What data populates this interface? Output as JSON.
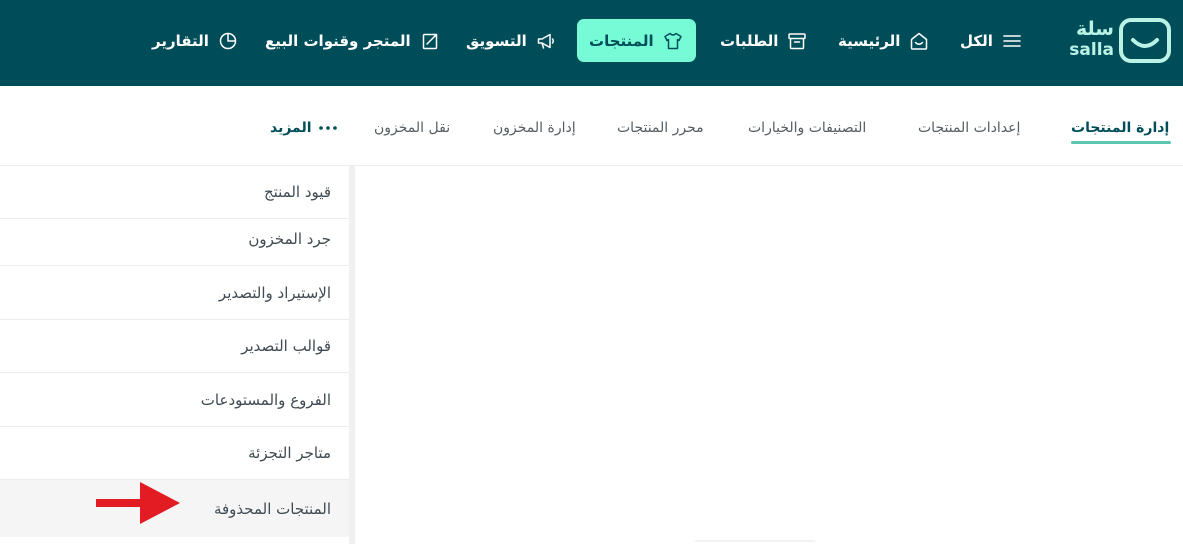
{
  "brand": {
    "name_ar": "سلة",
    "name_latin": "salla"
  },
  "nav": {
    "menu_label": "الكل",
    "items": [
      {
        "key": "home",
        "label": "الرئيسية",
        "icon": "home-icon"
      },
      {
        "key": "orders",
        "label": "الطلبات",
        "icon": "archive-box-icon"
      },
      {
        "key": "products",
        "label": "المنتجات",
        "icon": "shirt-icon",
        "active": true
      },
      {
        "key": "marketing",
        "label": "التسويق",
        "icon": "megaphone-icon"
      },
      {
        "key": "channels",
        "label": "المتجر وقنوات البيع",
        "icon": "store-channels-icon"
      },
      {
        "key": "reports",
        "label": "التقارير",
        "icon": "pie-chart-icon"
      }
    ]
  },
  "tabs": {
    "items": [
      {
        "label": "إدارة المنتجات",
        "active": true
      },
      {
        "label": "إعدادات المنتجات"
      },
      {
        "label": "التصنيفات والخيارات"
      },
      {
        "label": "محرر المنتجات"
      },
      {
        "label": "إدارة المخزون"
      },
      {
        "label": "نقل المخزون"
      }
    ],
    "more_label": "المزيد"
  },
  "menu": {
    "items": [
      {
        "label": "قيود المنتج"
      },
      {
        "label": "جرد المخزون"
      },
      {
        "label": "الإستيراد والتصدير"
      },
      {
        "label": "قوالب التصدير"
      },
      {
        "label": "الفروع والمستودعات"
      },
      {
        "label": "متاجر التجزئة"
      },
      {
        "label": "المنتجات المحذوفة",
        "highlighted": true
      }
    ]
  },
  "colors": {
    "topbar": "#004d5a",
    "accent": "#76fbd6",
    "logo": "#baf3e6",
    "tab_underline": "#5bc5b4",
    "arrow": "#e31b23"
  }
}
